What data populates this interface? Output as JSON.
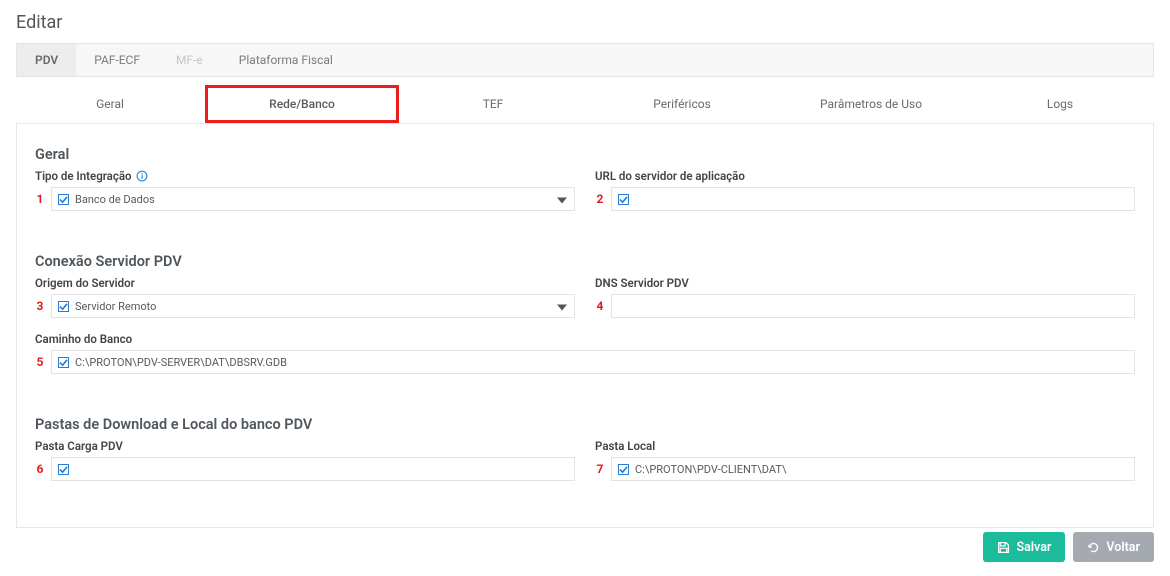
{
  "page_title": "Editar",
  "top_tabs": {
    "pdv": "PDV",
    "paf_ecf": "PAF-ECF",
    "mf_e": "MF-e",
    "plataforma_fiscal": "Plataforma Fiscal"
  },
  "sub_tabs": {
    "geral": "Geral",
    "rede_banco": "Rede/Banco",
    "tef": "TEF",
    "perifericos": "Periféricos",
    "parametros": "Parâmetros de Uso",
    "logs": "Logs"
  },
  "sections": {
    "geral": {
      "title": "Geral",
      "tipo_integracao": {
        "marker": "1",
        "label": "Tipo de Integração",
        "value": "Banco de Dados",
        "checked": true
      },
      "url_servidor_app": {
        "marker": "2",
        "label": "URL do servidor de aplicação",
        "value": "",
        "checked": true
      }
    },
    "conexao": {
      "title": "Conexão Servidor PDV",
      "origem_servidor": {
        "marker": "3",
        "label": "Origem do Servidor",
        "value": "Servidor Remoto",
        "checked": true
      },
      "dns_servidor": {
        "marker": "4",
        "label": "DNS Servidor PDV",
        "value": "",
        "checked": false
      },
      "caminho_banco": {
        "marker": "5",
        "label": "Caminho do Banco",
        "value": "C:\\PROTON\\PDV-SERVER\\DAT\\DBSRV.GDB",
        "checked": true
      }
    },
    "pastas": {
      "title": "Pastas de Download e Local do banco PDV",
      "pasta_carga": {
        "marker": "6",
        "label": "Pasta Carga PDV",
        "value": "",
        "checked": true
      },
      "pasta_local": {
        "marker": "7",
        "label": "Pasta Local",
        "value": "C:\\PROTON\\PDV-CLIENT\\DAT\\",
        "checked": true
      }
    }
  },
  "buttons": {
    "save": "Salvar",
    "back": "Voltar"
  }
}
